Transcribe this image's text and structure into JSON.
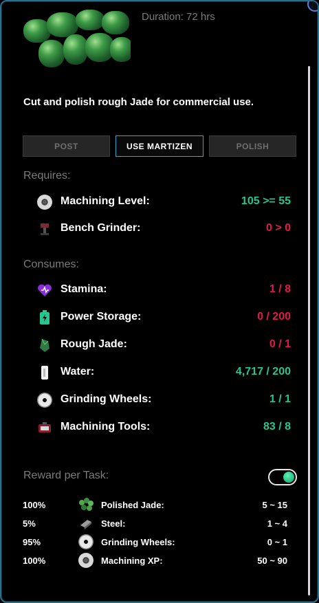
{
  "header": {
    "duration": "Duration: 72 hrs"
  },
  "description": "Cut and polish rough Jade for commercial use.",
  "buttons": {
    "post": "POST",
    "use_martizen": "USE MARTIZEN",
    "polish": "POLISH"
  },
  "requires": {
    "label": "Requires:",
    "items": [
      {
        "label": "Machining Level:",
        "value": "105 >= 55",
        "status": "ok",
        "icon": "machining-gear-icon"
      },
      {
        "label": "Bench Grinder:",
        "value": "0 > 0",
        "status": "bad",
        "icon": "bench-grinder-icon"
      }
    ]
  },
  "consumes": {
    "label": "Consumes:",
    "items": [
      {
        "label": "Stamina:",
        "value": "1 / 8",
        "status": "bad",
        "icon": "stamina-heart-icon"
      },
      {
        "label": "Power Storage:",
        "value": "0 / 200",
        "status": "bad",
        "icon": "battery-icon"
      },
      {
        "label": "Rough Jade:",
        "value": "0 / 1",
        "status": "bad",
        "icon": "rough-jade-icon"
      },
      {
        "label": "Water:",
        "value": "4,717 / 200",
        "status": "ok",
        "icon": "water-icon"
      },
      {
        "label": "Grinding Wheels:",
        "value": "1 / 1",
        "status": "ok",
        "icon": "grinding-wheel-icon"
      },
      {
        "label": "Machining Tools:",
        "value": "83 / 8",
        "status": "ok",
        "icon": "machining-tools-icon"
      }
    ]
  },
  "reward": {
    "label": "Reward per Task:",
    "toggle_on": true,
    "items": [
      {
        "pct": "100%",
        "label": "Polished Jade:",
        "range": "5 ~ 15",
        "icon": "polished-jade-icon"
      },
      {
        "pct": "5%",
        "label": "Steel:",
        "range": "1 ~ 4",
        "icon": "steel-icon"
      },
      {
        "pct": "95%",
        "label": "Grinding Wheels:",
        "range": "0 ~ 1",
        "icon": "grinding-wheel-icon"
      },
      {
        "pct": "100%",
        "label": "Machining XP:",
        "range": "50 ~ 90",
        "icon": "machining-xp-icon"
      }
    ]
  },
  "colors": {
    "ok": "#27c591",
    "bad": "#e3194a",
    "accent": "#3aa6d0",
    "muted": "#7b7b7b"
  }
}
